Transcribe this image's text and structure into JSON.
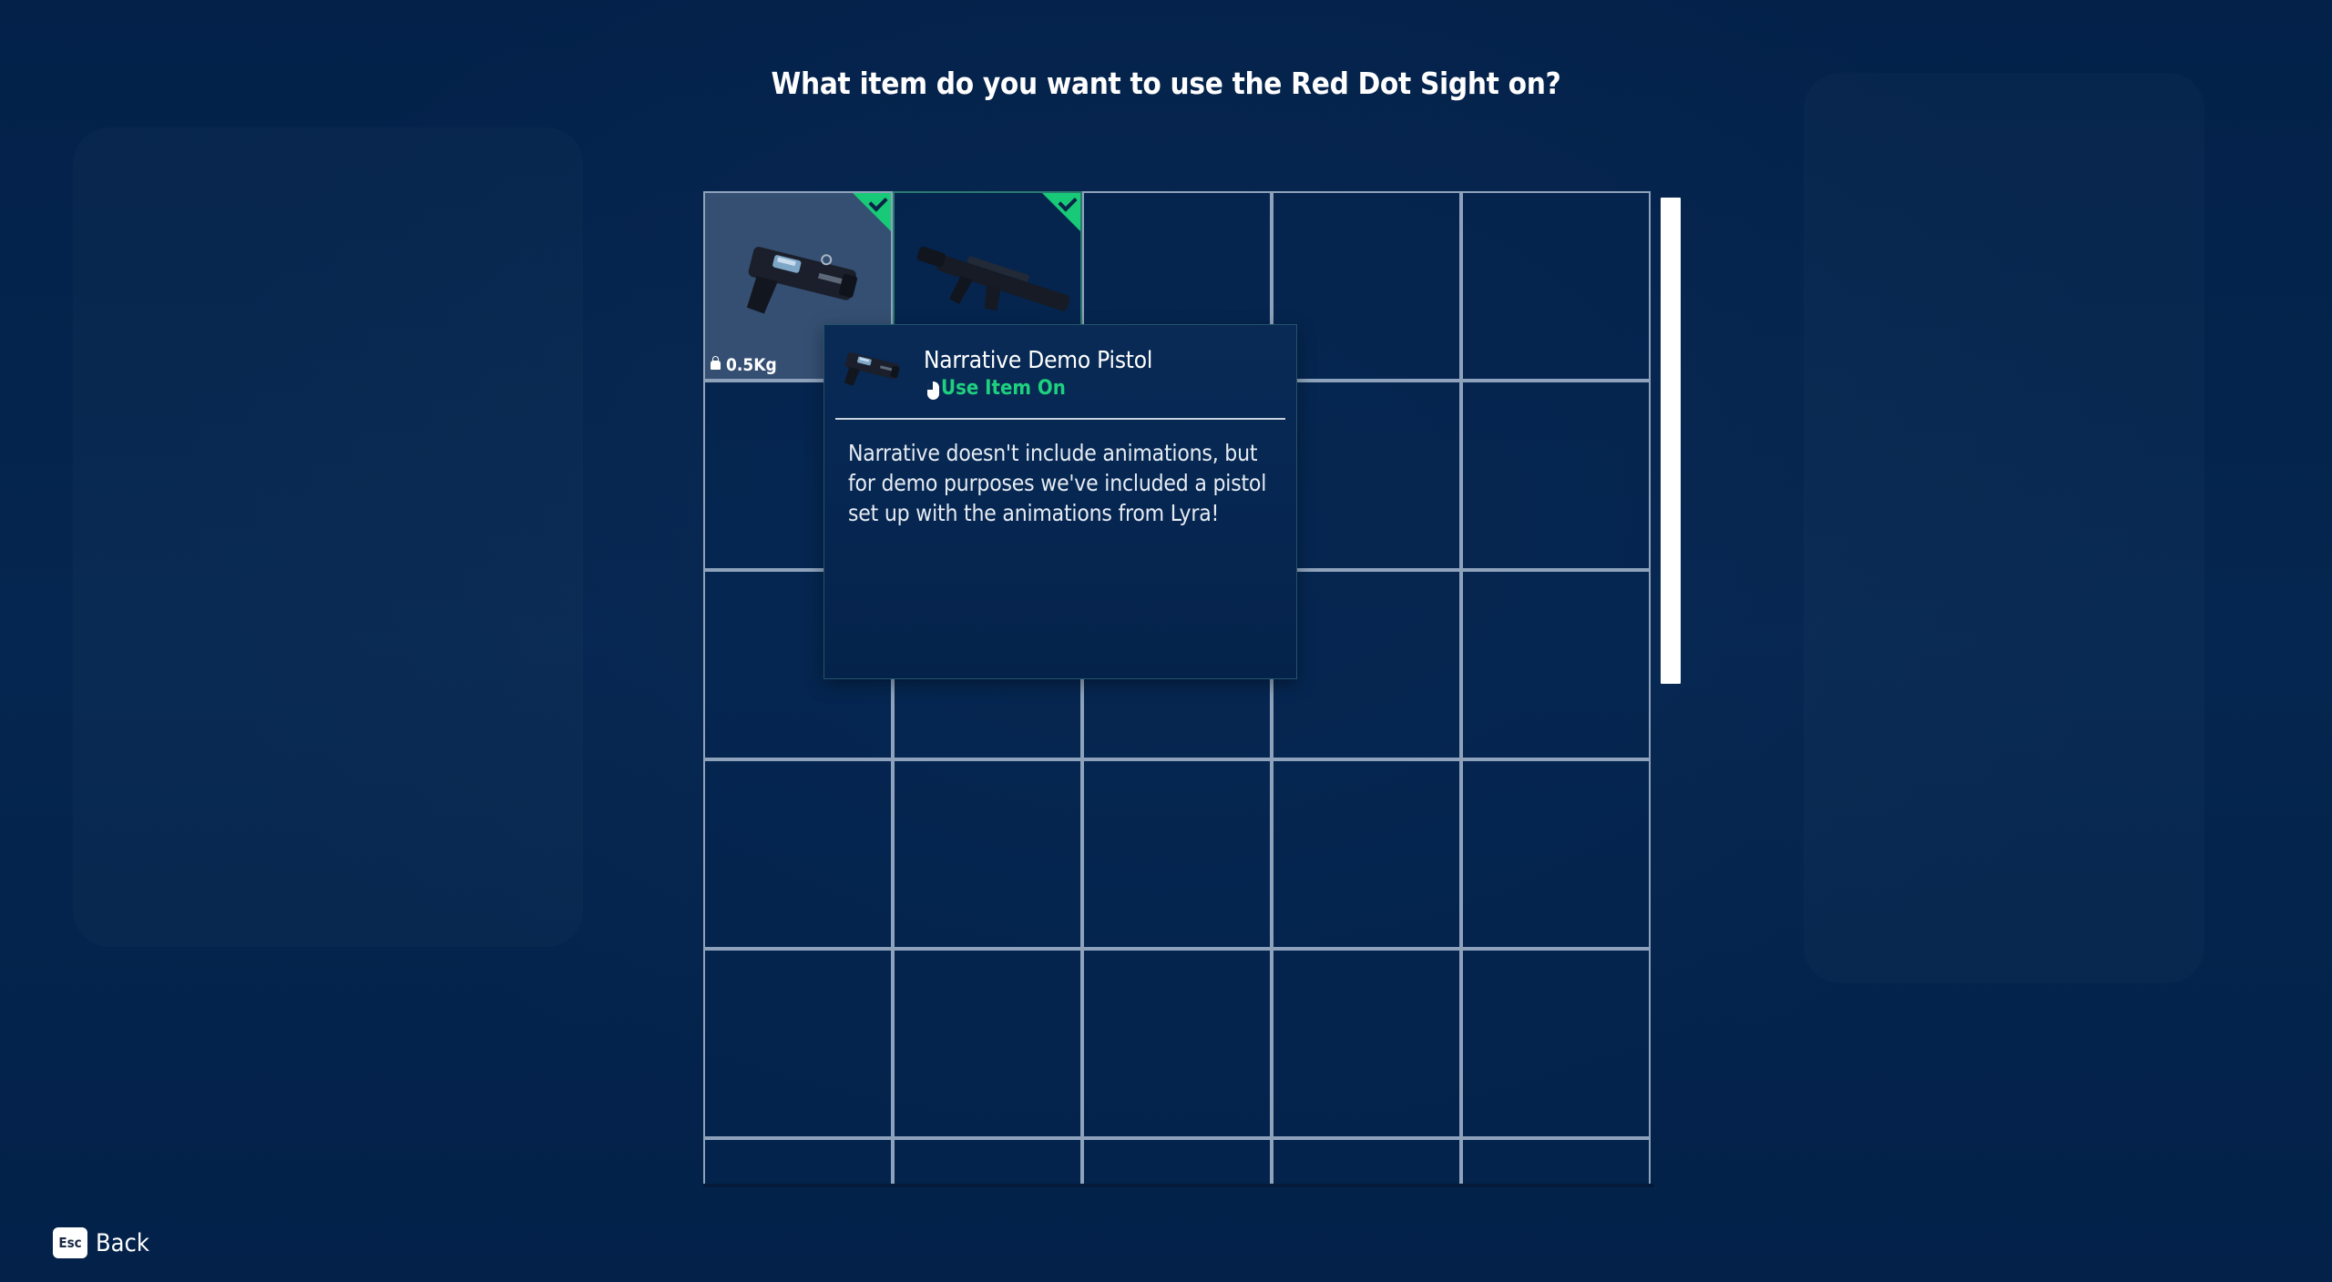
{
  "prompt": {
    "title": "What item do you want to use the Red Dot Sight on?"
  },
  "inventory": {
    "columns": 5,
    "rows_visible": 6,
    "slots": [
      {
        "item": "pistol",
        "icon": "pistol-icon",
        "weight": "0.5Kg",
        "selected": true,
        "valid_target": true
      },
      {
        "item": "rifle",
        "icon": "rifle-icon",
        "weight": "",
        "selected": false,
        "valid_target": true
      }
    ],
    "scroll_fraction_visible": 0.49
  },
  "tooltip": {
    "item_name": "Narrative Demo Pistol",
    "action_icon": "mouse-left-click-icon",
    "action_label": "Use Item On",
    "description": "Narrative doesn't include animations, but for demo purposes we've included a pistol set up with the animations from Lyra!"
  },
  "footer": {
    "back_key": "Esc",
    "back_label": "Back"
  },
  "colors": {
    "background": "#03224a",
    "grid_line": "#8ea2bb",
    "selected_slot": "#354f72",
    "valid_marker": "#18c977",
    "action_text": "#1fd07e"
  }
}
